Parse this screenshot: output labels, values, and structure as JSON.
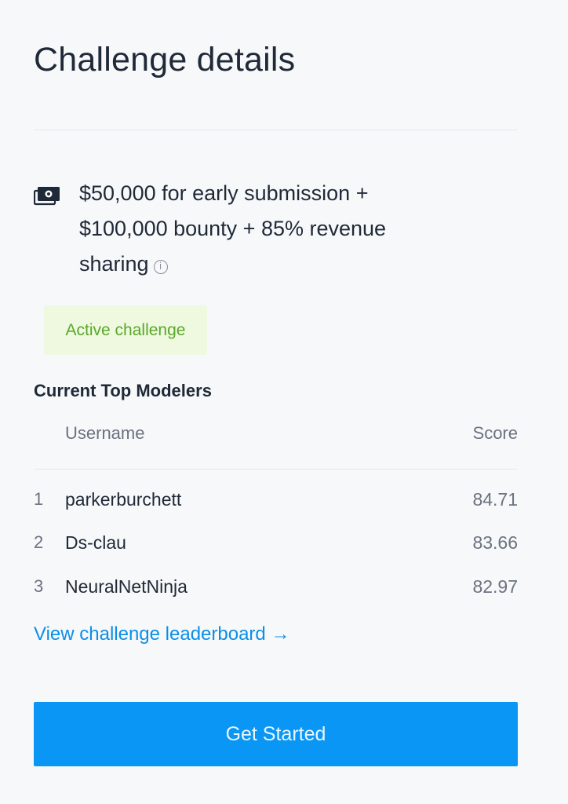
{
  "header": {
    "title": "Challenge details"
  },
  "prize": {
    "icon": "money-icon",
    "text": "$50,000 for early submission + $100,000 bounty + 85% revenue sharing",
    "info_icon": "info-icon",
    "info_glyph": "i"
  },
  "status": {
    "label": "Active challenge",
    "color": "#5aa72a",
    "background": "#eef9df"
  },
  "modelers": {
    "section_title": "Current Top Modelers",
    "columns": {
      "username": "Username",
      "score": "Score"
    },
    "rows": [
      {
        "rank": "1",
        "username": "parkerburchett",
        "score": "84.71"
      },
      {
        "rank": "2",
        "username": "Ds-clau",
        "score": "83.66"
      },
      {
        "rank": "3",
        "username": "NeuralNetNinja",
        "score": "82.97"
      }
    ]
  },
  "links": {
    "leaderboard": "View challenge leaderboard →"
  },
  "actions": {
    "get_started": "Get Started",
    "accent_color": "#0a96f5"
  }
}
